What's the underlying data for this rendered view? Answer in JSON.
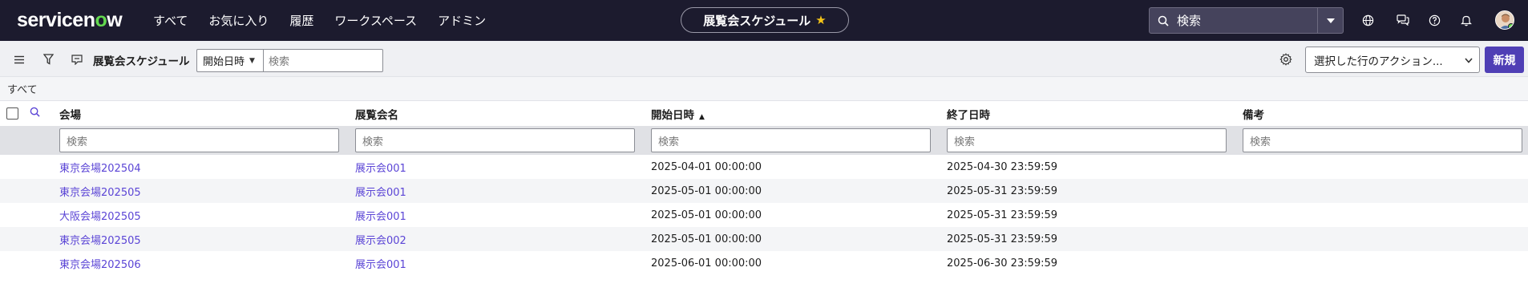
{
  "topbar": {
    "logo_pre": "servicen",
    "logo_o": "o",
    "logo_post": "w",
    "nav": [
      "すべて",
      "お気に入り",
      "履歴",
      "ワークスペース",
      "アドミン"
    ],
    "context_title": "展覧会スケジュール",
    "global_search_placeholder": "検索",
    "icons": [
      "globe-icon",
      "chat-icon",
      "help-icon",
      "bell-icon"
    ]
  },
  "list": {
    "title": "展覧会スケジュール",
    "search_field": "開始日時",
    "search_placeholder": "検索",
    "action_select": "選択した行のアクション...",
    "new_button": "新規",
    "breadcrumb": "すべて"
  },
  "table": {
    "columns": [
      "会場",
      "展覧会名",
      "開始日時",
      "終了日時",
      "備考"
    ],
    "sorted_column": "開始日時",
    "sort_direction": "ascending",
    "filter_placeholder": "検索",
    "rows": [
      [
        "東京会場202504",
        "展示会001",
        "2025-04-01 00:00:00",
        "2025-04-30 23:59:59",
        ""
      ],
      [
        "東京会場202505",
        "展示会001",
        "2025-05-01 00:00:00",
        "2025-05-31 23:59:59",
        ""
      ],
      [
        "大阪会場202505",
        "展示会001",
        "2025-05-01 00:00:00",
        "2025-05-31 23:59:59",
        ""
      ],
      [
        "東京会場202505",
        "展示会002",
        "2025-05-01 00:00:00",
        "2025-05-31 23:59:59",
        ""
      ],
      [
        "東京会場202506",
        "展示会001",
        "2025-06-01 00:00:00",
        "2025-06-30 23:59:59",
        ""
      ]
    ]
  },
  "colors": {
    "topbar_bg": "#1c1b2e",
    "accent": "#4f3fb5",
    "link": "#5b45d6",
    "logo_accent": "#62d84e",
    "star": "#f5c518"
  }
}
